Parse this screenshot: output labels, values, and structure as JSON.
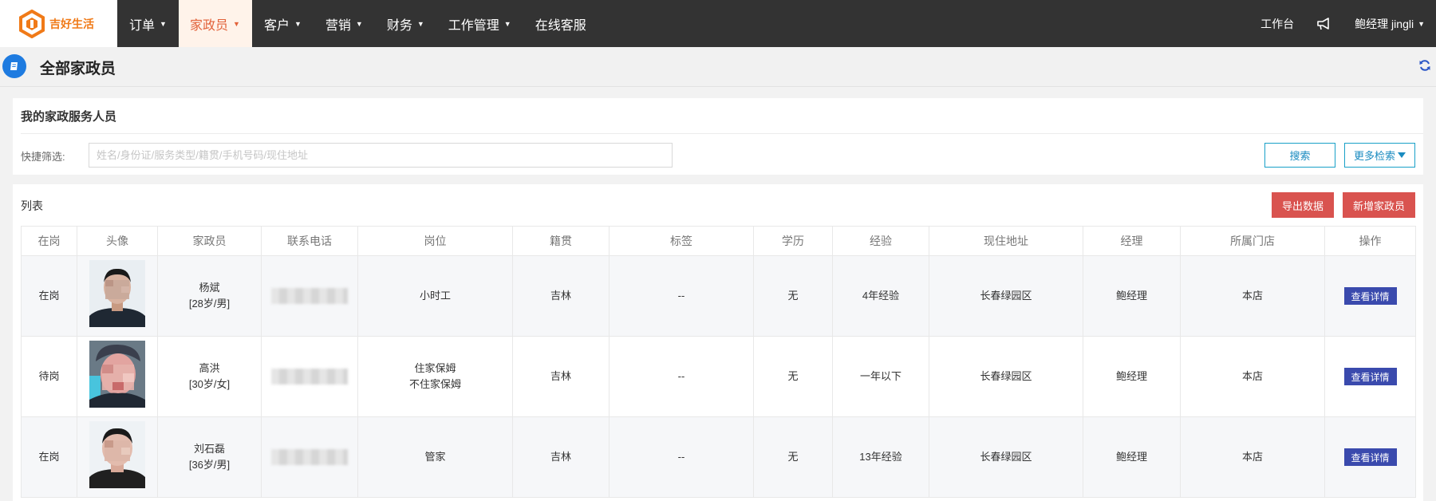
{
  "app": {
    "logo_text": "吉好生活"
  },
  "nav": {
    "items": [
      {
        "label": "订单",
        "dropdown": true,
        "active": false
      },
      {
        "label": "家政员",
        "dropdown": true,
        "active": true
      },
      {
        "label": "客户",
        "dropdown": true,
        "active": false
      },
      {
        "label": "营销",
        "dropdown": true,
        "active": false
      },
      {
        "label": "财务",
        "dropdown": true,
        "active": false
      },
      {
        "label": "工作管理",
        "dropdown": true,
        "active": false
      },
      {
        "label": "在线客服",
        "dropdown": false,
        "active": false
      }
    ],
    "workbench": "工作台",
    "user": "鲍经理 jingli"
  },
  "page": {
    "title": "全部家政员"
  },
  "panel1": {
    "title": "我的家政服务人员",
    "filter_label": "快捷筛选:",
    "filter_placeholder": "姓名/身份证/服务类型/籍贯/手机号码/现住地址",
    "search_button": "搜索",
    "more_button": "更多检索"
  },
  "panel2": {
    "title": "列表",
    "export_button": "导出数据",
    "new_button": "新增家政员"
  },
  "table": {
    "headers": [
      "在岗",
      "头像",
      "家政员",
      "联系电话",
      "岗位",
      "籍贯",
      "标签",
      "学历",
      "经验",
      "现住地址",
      "经理",
      "所属门店",
      "操作"
    ],
    "rows": [
      {
        "status": "在岗",
        "name": "杨斌",
        "info": "[28岁/男]",
        "positions": [
          "小时工"
        ],
        "hometown": "吉林",
        "tags": "--",
        "education": "无",
        "experience": "4年经验",
        "address": "长春绿园区",
        "manager": "鲍经理",
        "store": "本店",
        "action": "查看详情"
      },
      {
        "status": "待岗",
        "name": "高洪",
        "info": "[30岁/女]",
        "positions": [
          "住家保姆",
          "不住家保姆"
        ],
        "hometown": "吉林",
        "tags": "--",
        "education": "无",
        "experience": "一年以下",
        "address": "长春绿园区",
        "manager": "鲍经理",
        "store": "本店",
        "action": "查看详情"
      },
      {
        "status": "在岗",
        "name": "刘石磊",
        "info": "[36岁/男]",
        "positions": [
          "管家"
        ],
        "hometown": "吉林",
        "tags": "--",
        "education": "无",
        "experience": "13年经验",
        "address": "长春绿园区",
        "manager": "鲍经理",
        "store": "本店",
        "action": "查看详情"
      }
    ]
  },
  "colors": {
    "navbar": "#333333",
    "accent_orange": "#e2623a",
    "status_on": "#22b07d",
    "status_wait": "#2f9ec9",
    "danger": "#d9534f",
    "detail_button": "#3a4aad"
  }
}
